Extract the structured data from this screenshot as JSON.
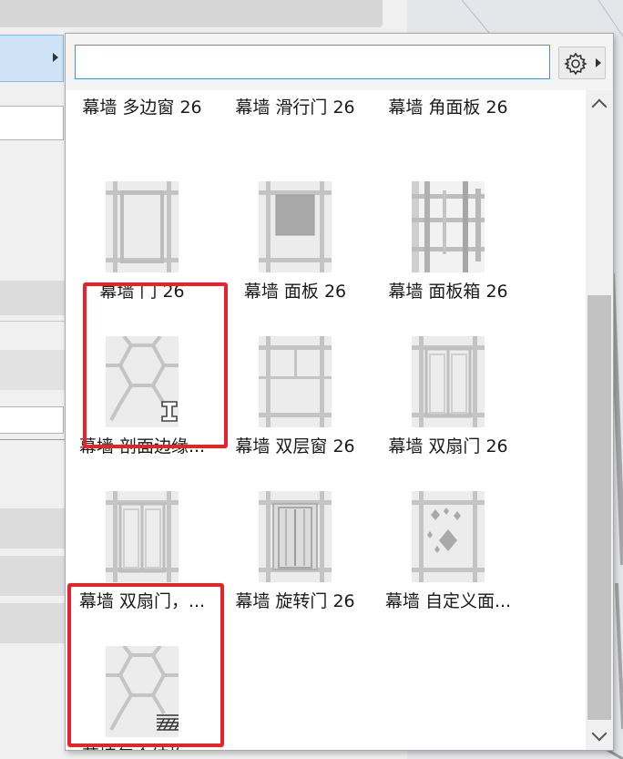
{
  "search": {
    "value": "",
    "placeholder": ""
  },
  "settings_button": {
    "icon": "gear-icon"
  },
  "rows": [
    {
      "items": [
        {
          "label": "幕墙 多边窗 26",
          "icon": ""
        },
        {
          "label": "幕墙 滑行门 26",
          "icon": ""
        },
        {
          "label": "幕墙 角面板 26",
          "icon": ""
        }
      ]
    },
    {
      "items": [
        {
          "label": "幕墙 门 26",
          "icon": "curtain-wall-door-thumbnail"
        },
        {
          "label": "幕墙 面板 26",
          "icon": "curtain-wall-panel-thumbnail"
        },
        {
          "label": "幕墙 面板箱 26",
          "icon": "curtain-wall-panel-box-thumbnail"
        }
      ]
    },
    {
      "items": [
        {
          "label": "幕墙 剖面边缘...",
          "icon": "curtain-wall-section-edge-thumbnail",
          "highlighted": true
        },
        {
          "label": "幕墙 双层窗 26",
          "icon": "curtain-wall-double-window-thumbnail"
        },
        {
          "label": "幕墙 双扇门 26",
          "icon": "curtain-wall-double-door-thumbnail"
        }
      ]
    },
    {
      "items": [
        {
          "label": "幕墙 双扇门，...",
          "icon": "curtain-wall-double-door-2-thumbnail"
        },
        {
          "label": "幕墙 旋转门 26",
          "icon": "curtain-wall-revolving-door-thumbnail"
        },
        {
          "label": "幕墙 自定义面...",
          "icon": "curtain-wall-custom-panel-thumbnail"
        }
      ]
    },
    {
      "items": [
        {
          "label": "幕墙复合结构...",
          "icon": "curtain-wall-composite-thumbnail",
          "highlighted": true
        }
      ]
    }
  ],
  "colors": {
    "highlight": "#e8222c",
    "accent": "#4b8fd1"
  }
}
